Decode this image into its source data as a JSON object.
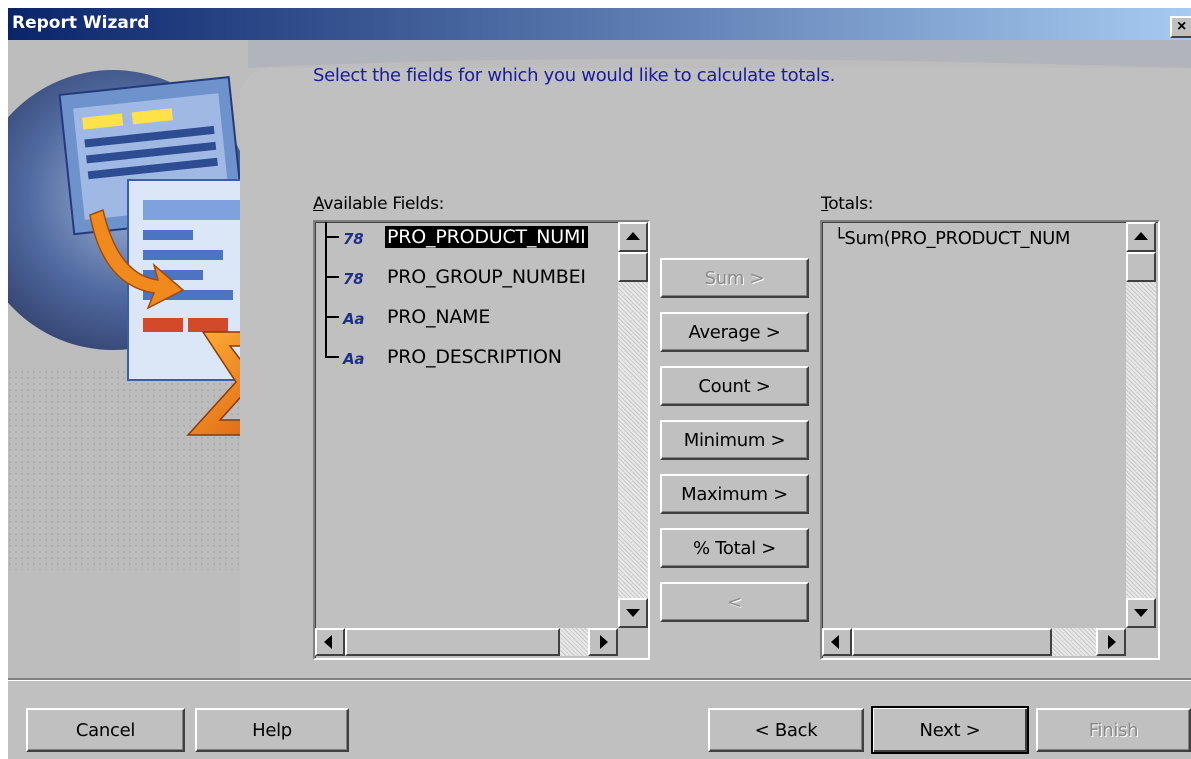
{
  "window": {
    "title": "Report Wizard",
    "close_glyph": "×"
  },
  "instruction": "Select the fields for which you would like to calculate totals.",
  "available": {
    "label_accel": "A",
    "label_rest": "vailable Fields:",
    "items": [
      {
        "icon_glyph": "78",
        "icon": "numeric-field-icon",
        "name": "PRO_PRODUCT_NUMI",
        "selected": true
      },
      {
        "icon_glyph": "78",
        "icon": "numeric-field-icon",
        "name": "PRO_GROUP_NUMBEI",
        "selected": false
      },
      {
        "icon_glyph": "Aa",
        "icon": "text-field-icon",
        "name": "PRO_NAME",
        "selected": false
      },
      {
        "icon_glyph": "Aa",
        "icon": "text-field-icon",
        "name": "PRO_DESCRIPTION",
        "selected": false
      }
    ]
  },
  "actions": {
    "sum": "Sum  >",
    "average": "Average >",
    "count": "Count  >",
    "minimum": "Minimum >",
    "maximum": "Maximum >",
    "pct_total": "% Total >",
    "remove": "<"
  },
  "totals": {
    "label_accel": "T",
    "label_rest": "otals:",
    "items": [
      "└Sum(PRO_PRODUCT_NUM"
    ]
  },
  "footer": {
    "cancel": "Cancel",
    "help": "Help",
    "back": "< Back",
    "next": "Next >",
    "finish": "Finish"
  },
  "colors": {
    "titlebar_start": "#0a246a",
    "titlebar_end": "#a6caf0",
    "instruction_text": "#1a1a9c",
    "face": "#c0c0c0"
  }
}
